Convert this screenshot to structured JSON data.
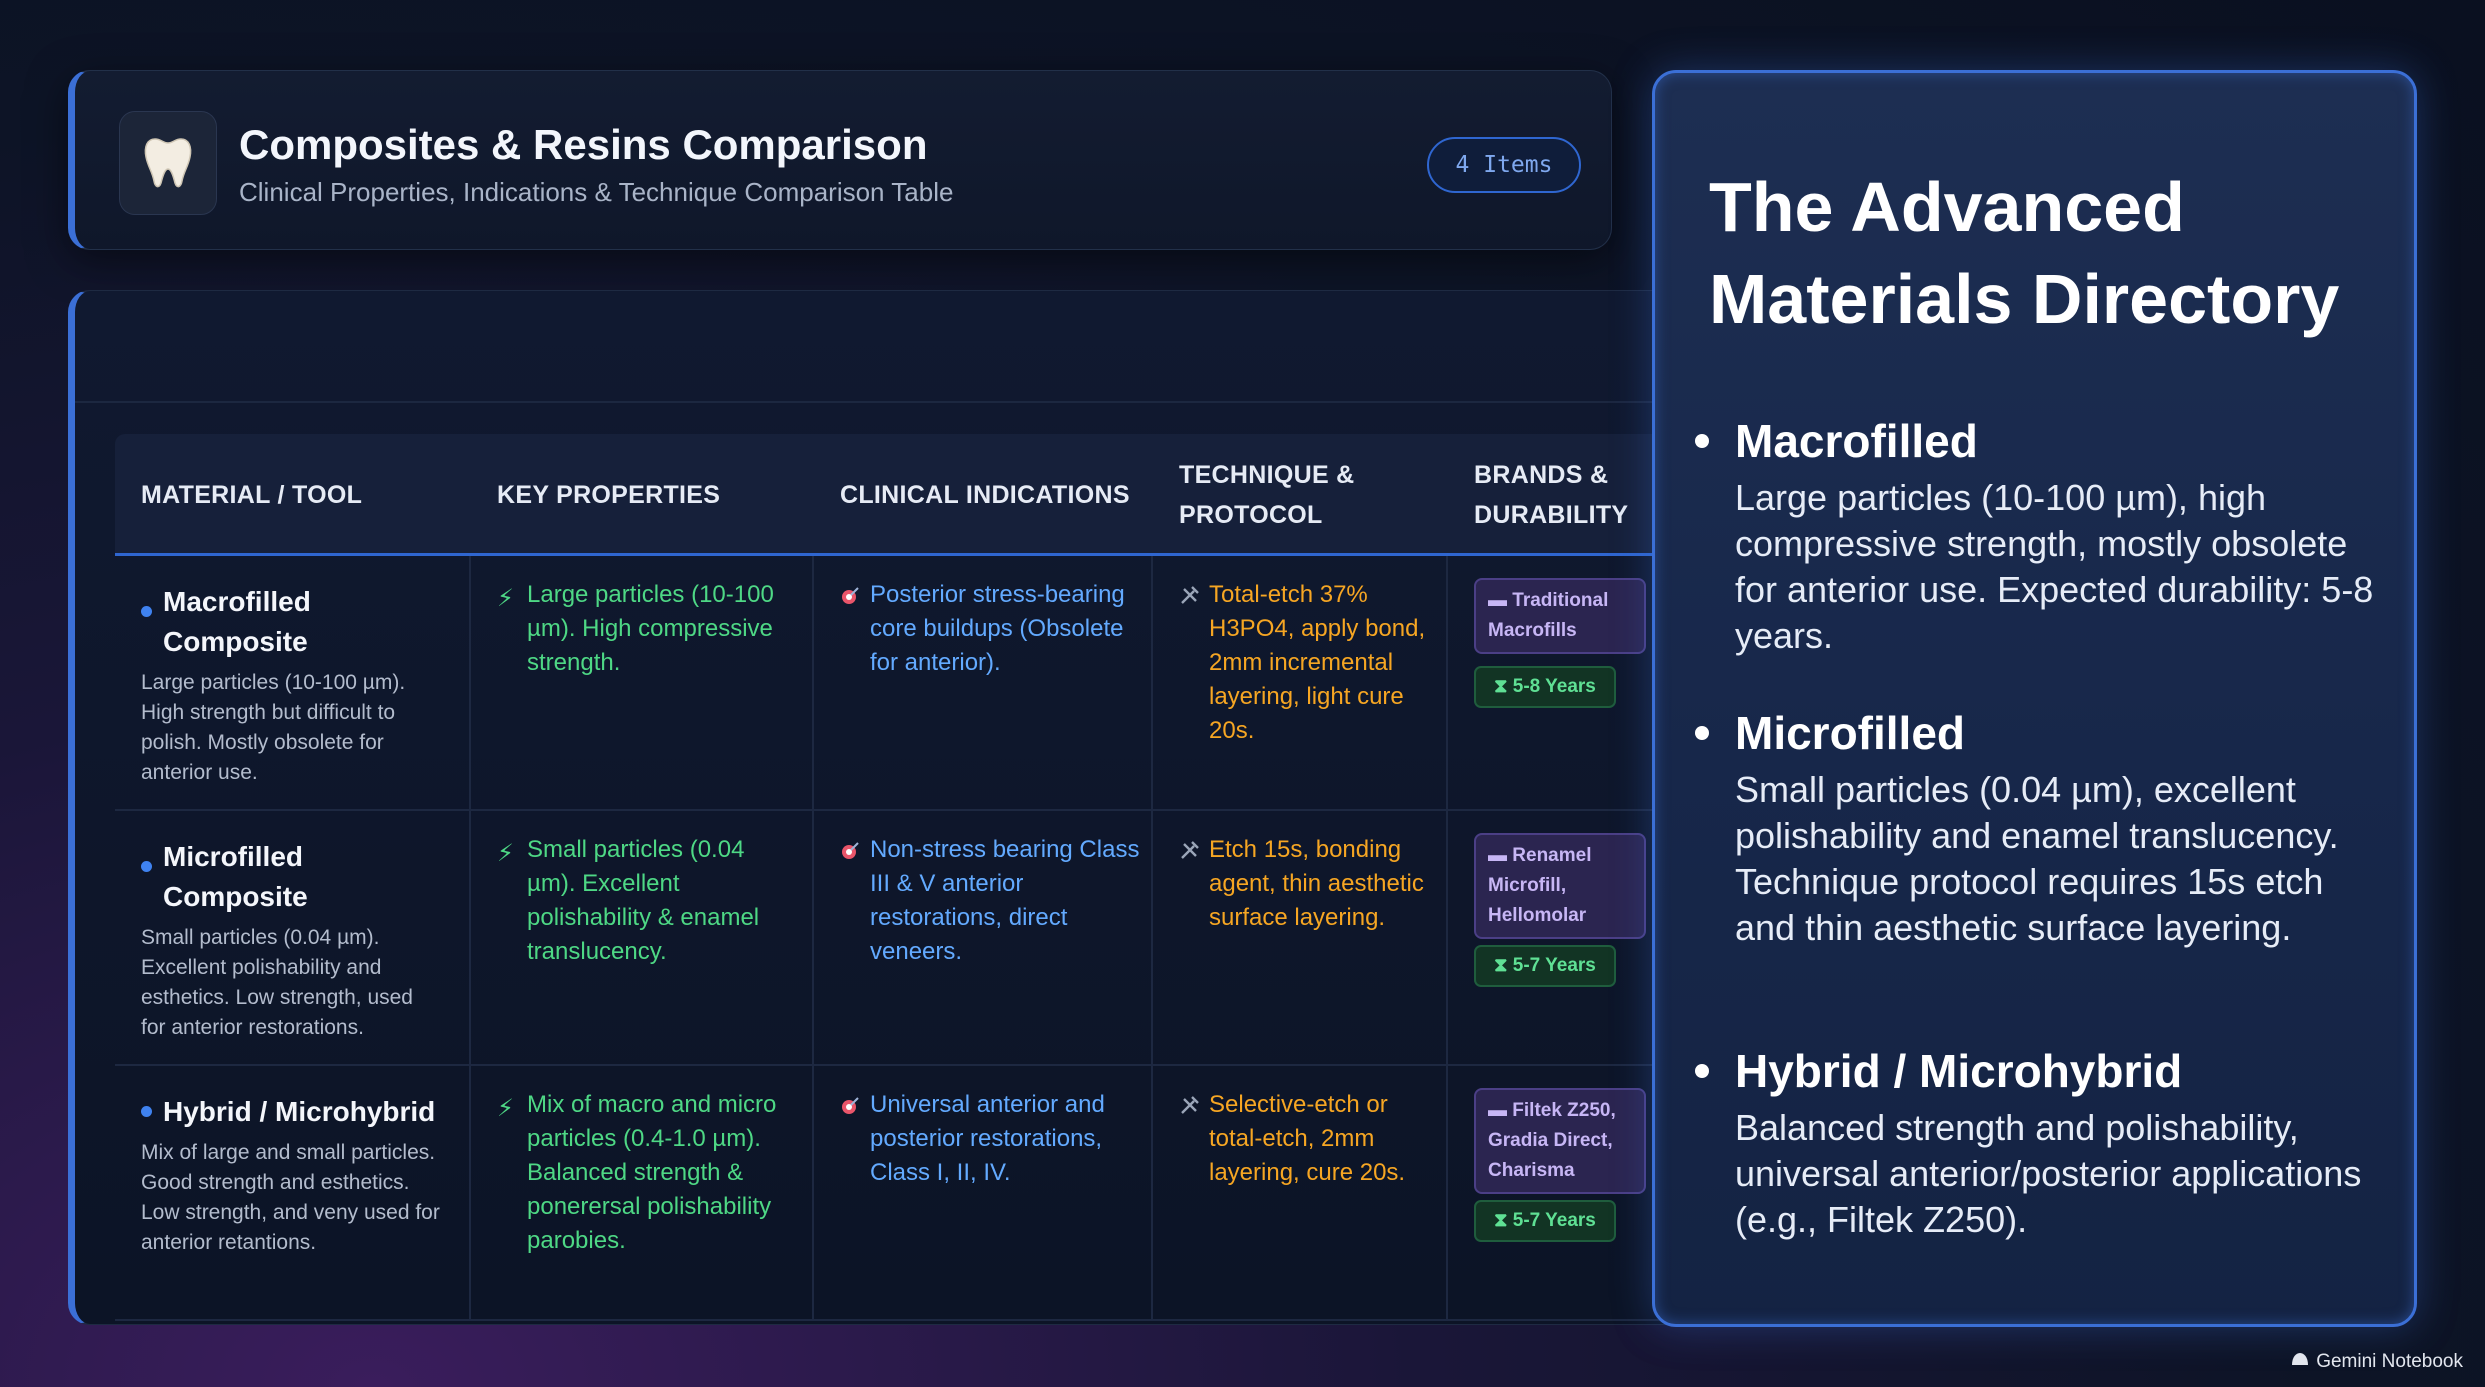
{
  "header": {
    "title": "Composites & Resins Comparison",
    "subtitle": "Clinical Properties, Indications & Technique Comparison Table",
    "items_badge": "4 Items",
    "icon": "tooth-icon"
  },
  "table": {
    "columns": [
      "MATERIAL / TOOL",
      "KEY PROPERTIES",
      "CLINICAL INDICATIONS",
      "TECHNIQUE & PROTOCOL",
      "BRANDS & DURABILITY"
    ],
    "rows": [
      {
        "name": "Macrofilled Composite",
        "description": "Large particles (10-100 µm). High strength but difficult to polish. Mostly obsolete for anterior use.",
        "properties": "Large particles (10-100 µm). High compressive strength.",
        "indications": "Posterior stress-bearing core buildups (Obsolete for anterior).",
        "technique": "Total-etch 37% H3PO4, apply bond, 2mm incremental layering, light cure 20s.",
        "brands": "Traditional Macrofills",
        "durability": "5-8 Years"
      },
      {
        "name": "Microfilled Composite",
        "description": "Small particles (0.04 µm). Excellent polishability and esthetics. Low strength, used for anterior restorations.",
        "properties": "Small particles (0.04 µm). Excellent polishability & enamel translucency.",
        "indications": "Non-stress bearing Class III & V anterior restorations, direct veneers.",
        "technique": "Etch 15s, bonding agent, thin aesthetic surface layering.",
        "brands": "Renamel Microfill, Hellomolar",
        "durability": "5-7 Years"
      },
      {
        "name": "Hybrid / Microhybrid",
        "description": "Mix of large and small particles. Good strength and esthetics. Low strength, and veny used for anterior retantions.",
        "properties": "Mix of macro and micro particles (0.4-1.0 µm). Balanced strength & ponerersal polishability parobies.",
        "indications": "Universal anterior and posterior restorations, Class I, II, IV.",
        "technique": "Selective-etch or total-etch, 2mm layering, cure 20s.",
        "brands": "Filtek Z250, Gradia Direct, Charisma",
        "durability": "5-7 Years"
      }
    ]
  },
  "panel": {
    "title": "The Advanced Materials Directory",
    "items": [
      {
        "heading": "Macrofilled",
        "body": "Large particles (10-100 µm), high compressive strength, mostly obsolete for anterior use. Expected durability: 5-8 years."
      },
      {
        "heading": "Microfilled",
        "body": "Small particles (0.04 µm), excellent polishability and enamel translucency. Technique protocol requires 15s etch and thin aesthetic surface layering."
      },
      {
        "heading": "Hybrid / Microhybrid",
        "body": "Balanced strength and polishability, universal anterior/posterior applications (e.g., Filtek Z250)."
      }
    ]
  },
  "footer": {
    "brand": "Gemini Notebook"
  },
  "colors": {
    "accent": "#3b6fd6",
    "properties": "#4ed885",
    "indications": "#63aaff",
    "technique": "#f6a623",
    "brand_badge": "#c7b6f5"
  }
}
